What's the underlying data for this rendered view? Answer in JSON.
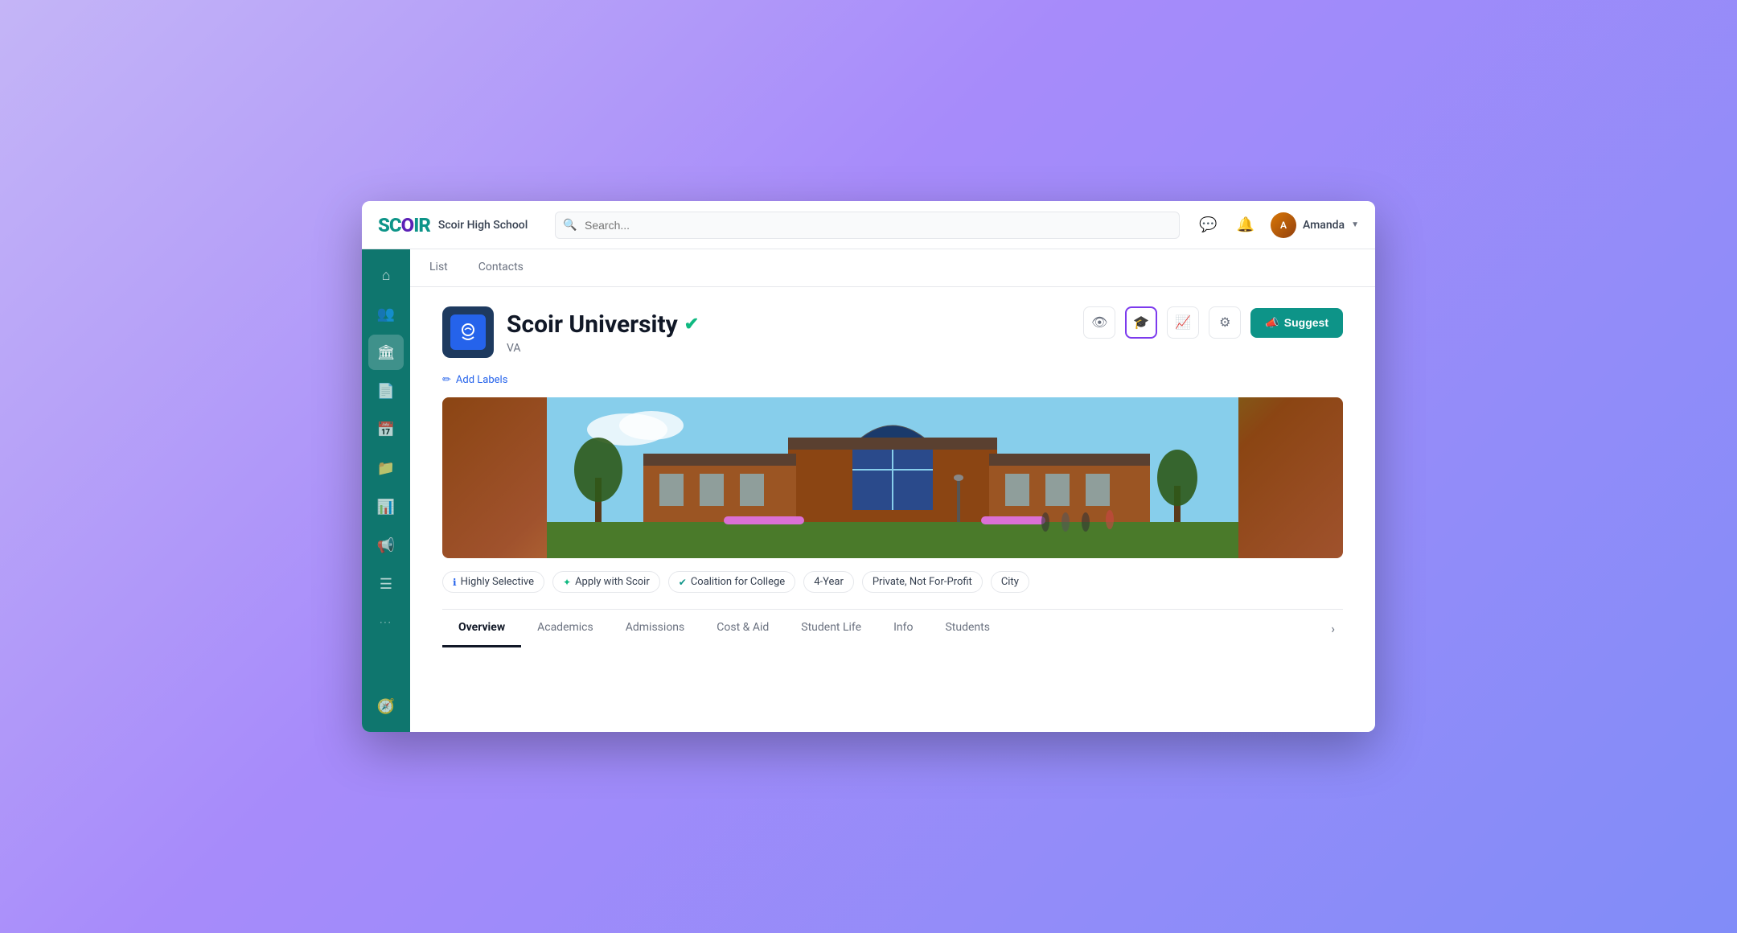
{
  "app": {
    "logo": "SCOIR",
    "school": "Scoir High School",
    "search_placeholder": "Search...",
    "user_name": "Amanda"
  },
  "sidebar": {
    "items": [
      {
        "id": "home",
        "icon": "⌂",
        "active": false
      },
      {
        "id": "users",
        "icon": "👥",
        "active": false
      },
      {
        "id": "college",
        "icon": "🏛",
        "active": true
      },
      {
        "id": "doc",
        "icon": "📄",
        "active": false
      },
      {
        "id": "calendar",
        "icon": "📅",
        "active": false
      },
      {
        "id": "folder",
        "icon": "📁",
        "active": false
      },
      {
        "id": "chart",
        "icon": "📊",
        "active": false
      },
      {
        "id": "megaphone",
        "icon": "📢",
        "active": false
      },
      {
        "id": "list2",
        "icon": "☰",
        "active": false
      },
      {
        "id": "more",
        "icon": "•••",
        "active": false
      },
      {
        "id": "compass",
        "icon": "🧭",
        "active": false
      }
    ]
  },
  "sub_nav": {
    "items": [
      {
        "id": "list",
        "label": "List"
      },
      {
        "id": "contacts",
        "label": "Contacts"
      }
    ]
  },
  "college": {
    "name": "Scoir University",
    "state": "VA",
    "verified": true,
    "add_labels": "Add Labels",
    "suggest_label": "Suggest"
  },
  "tags": [
    {
      "id": "highly-selective",
      "label": "Highly Selective",
      "icon": "ℹ",
      "icon_class": "blue"
    },
    {
      "id": "apply-with-scoir",
      "label": "Apply with Scoir",
      "icon": "✦",
      "icon_class": "green"
    },
    {
      "id": "coalition-for-college",
      "label": "Coalition for College",
      "icon": "✔",
      "icon_class": "teal"
    },
    {
      "id": "4-year",
      "label": "4-Year",
      "icon": "",
      "icon_class": ""
    },
    {
      "id": "private-not-for-profit",
      "label": "Private, Not For-Profit",
      "icon": "",
      "icon_class": ""
    },
    {
      "id": "city",
      "label": "City",
      "icon": "",
      "icon_class": ""
    }
  ],
  "tabs": [
    {
      "id": "overview",
      "label": "Overview",
      "active": true
    },
    {
      "id": "academics",
      "label": "Academics",
      "active": false
    },
    {
      "id": "admissions",
      "label": "Admissions",
      "active": false
    },
    {
      "id": "cost-aid",
      "label": "Cost & Aid",
      "active": false
    },
    {
      "id": "student-life",
      "label": "Student Life",
      "active": false
    },
    {
      "id": "info",
      "label": "Info",
      "active": false
    },
    {
      "id": "students",
      "label": "Students",
      "active": false
    }
  ],
  "actions": {
    "eye_icon": "👁",
    "graduation_icon": "🎓",
    "chart_icon": "📈",
    "gear_icon": "⚙",
    "suggest": "Suggest"
  }
}
